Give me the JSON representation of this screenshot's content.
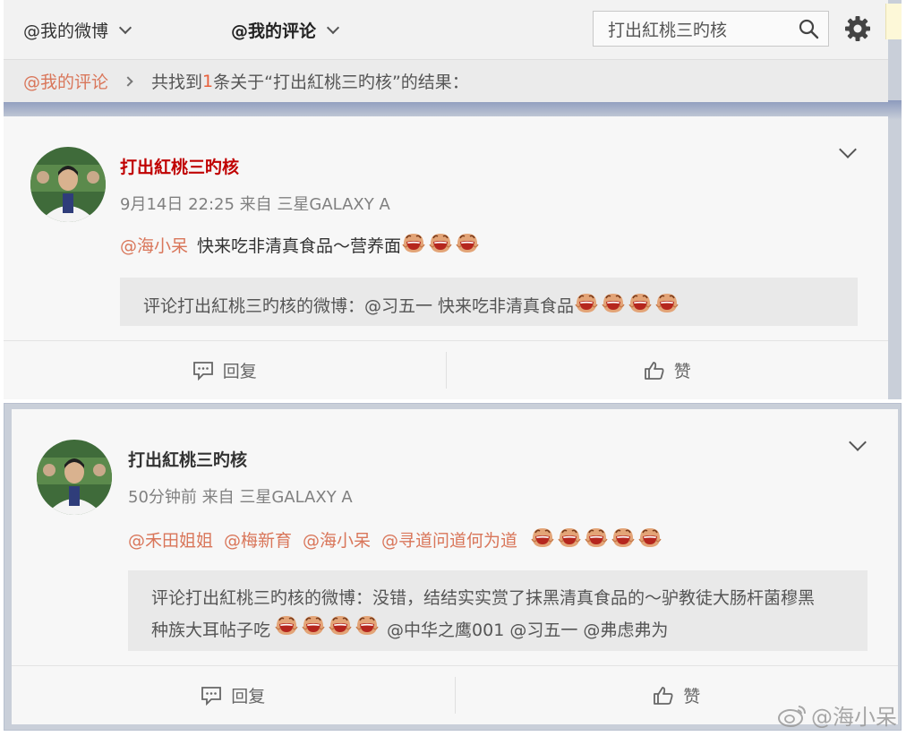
{
  "nav": {
    "my_weibo": "@我的微博",
    "my_comments": "@我的评论",
    "search_value": "打出紅桃三旳核"
  },
  "breadcrumb": {
    "root": "@我的评论",
    "prefix": "共找到",
    "count": "1",
    "suffix": "条关于“打出紅桃三旳核”的结果："
  },
  "posts": [
    {
      "author": "打出紅桃三旳核",
      "author_color": "#c00000",
      "meta": "9月14日 22:25 来自 三星GALAXY A",
      "mention": "@海小呆",
      "text": "快来吃非清真食品～营养面",
      "emoji_count": 3,
      "quote": "评论打出紅桃三旳核的微博：@习五一  快来吃非清真食品",
      "quote_emoji_count": 4,
      "reply": "回复",
      "like": "赞"
    },
    {
      "author": "打出紅桃三旳核",
      "author_color": "#333333",
      "meta": "50分钟前 来自 三星GALAXY A",
      "mentions": [
        "@禾田姐姐",
        "@梅新育",
        "@海小呆",
        "@寻道问道何为道"
      ],
      "emoji_count": 5,
      "quote_line1": "评论打出紅桃三旳核的微博：没错，结结实实赏了抹黑清真食品的～驴教徒大肠杆菌穆黑",
      "quote_line2_a": "种族大耳帖子吃",
      "quote_emoji_count": 4,
      "quote_line2_b": "@中华之鹰001  @习五一  @弗虑弗为",
      "reply": "回复",
      "like": "赞"
    }
  ],
  "watermark": "@海小呆",
  "colors": {
    "mention": "#d9765a",
    "accent": "#e8603b"
  },
  "icons": [
    "search-icon",
    "gear-icon",
    "chevron-down-icon",
    "comment-icon",
    "thumbs-up-icon",
    "laugh-emoji-icon",
    "weibo-logo-icon"
  ]
}
